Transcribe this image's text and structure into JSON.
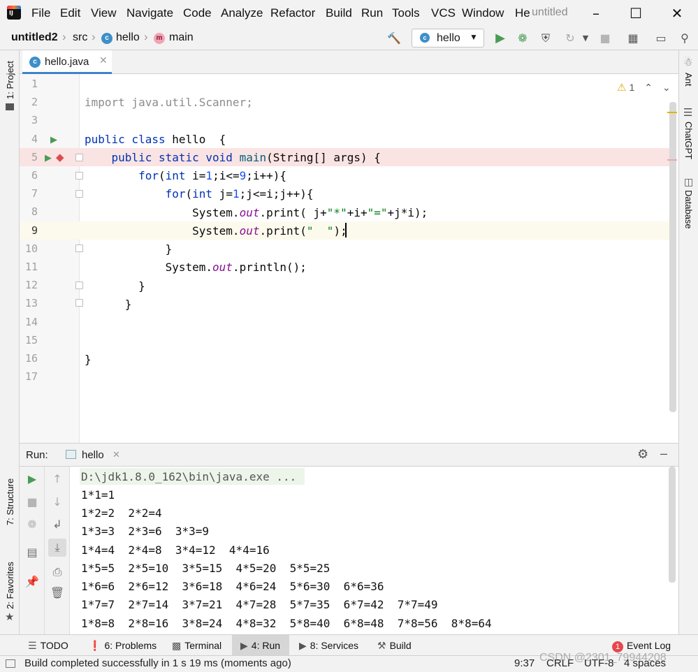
{
  "menubar": {
    "items": [
      {
        "label": "File",
        "u": "F"
      },
      {
        "label": "Edit",
        "u": "E"
      },
      {
        "label": "View",
        "u": "V"
      },
      {
        "label": "Navigate",
        "u": "N"
      },
      {
        "label": "Code",
        "u": "C"
      },
      {
        "label": "Analyze",
        "u": ""
      },
      {
        "label": "Refactor",
        "u": "R"
      },
      {
        "label": "Build",
        "u": "B"
      },
      {
        "label": "Run",
        "u": "u"
      },
      {
        "label": "Tools",
        "u": "T"
      },
      {
        "label": "VCS",
        "u": "S"
      },
      {
        "label": "Window",
        "u": "W"
      },
      {
        "label": "He",
        "u": "H"
      }
    ],
    "window_title": "untitled"
  },
  "navbar": {
    "project": "untitled2",
    "src": "src",
    "class": "hello",
    "method": "main",
    "run_config": "hello"
  },
  "left_stripe": {
    "project": "1: Project",
    "structure": "7: Structure",
    "favorites": "2: Favorites"
  },
  "right_stripe": {
    "ant": "Ant",
    "chatgpt": "ChatGPT",
    "database": "Database"
  },
  "editor": {
    "tab_label": "hello.java",
    "warnings": "1",
    "line_numbers": [
      "1",
      "2",
      "3",
      "4",
      "5",
      "6",
      "7",
      "8",
      "9",
      "10",
      "11",
      "12",
      "13",
      "14",
      "15",
      "16",
      "17"
    ]
  },
  "run_panel": {
    "label": "Run:",
    "tab": "hello",
    "console_lines": [
      "D:\\jdk1.8.0_162\\bin\\java.exe ...",
      "1*1=1",
      "1*2=2  2*2=4",
      "1*3=3  2*3=6  3*3=9",
      "1*4=4  2*4=8  3*4=12  4*4=16",
      "1*5=5  2*5=10  3*5=15  4*5=20  5*5=25",
      "1*6=6  2*6=12  3*6=18  4*6=24  5*6=30  6*6=36",
      "1*7=7  2*7=14  3*7=21  4*7=28  5*7=35  6*7=42  7*7=49",
      "1*8=8  2*8=16  3*8=24  4*8=32  5*8=40  6*8=48  7*8=56  8*8=64"
    ]
  },
  "bottom_tabs": {
    "todo": "TODO",
    "problems": "6: Problems",
    "terminal": "Terminal",
    "run": "4: Run",
    "services": "8: Services",
    "build": "Build",
    "event_log": "Event Log",
    "event_count": "1"
  },
  "status": {
    "message": "Build completed successfully in 1 s 19 ms (moments ago)",
    "position": "9:37",
    "line_sep": "CRLF",
    "encoding": "UTF-8",
    "indent": "4 spaces",
    "watermark": "CSDN @2301_79944208"
  },
  "colors": {
    "keyword": "#0033b3",
    "number": "#1750eb",
    "string": "#067d17",
    "field": "#871094",
    "accent": "#4083c9",
    "run_green": "#499c54"
  }
}
